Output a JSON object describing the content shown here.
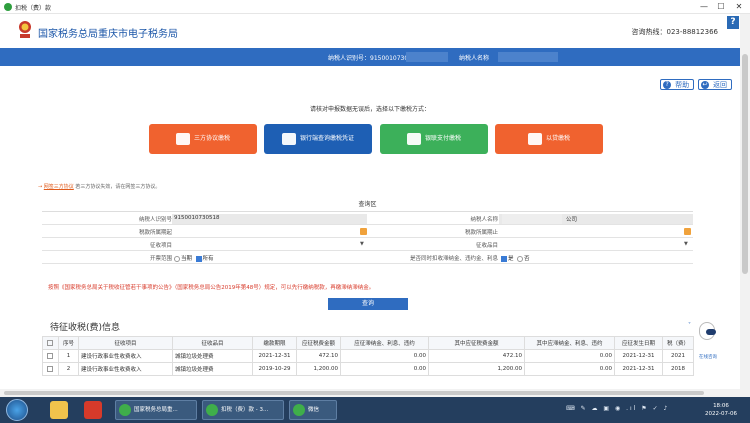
{
  "window": {
    "title": "扣税（费）款",
    "controls": {
      "minimize": "—",
      "maximize": "☐",
      "close": "✕"
    }
  },
  "header": {
    "site_title": "国家税务总局重庆市电子税务局",
    "hotline": "咨询热线：023-88812366",
    "help_tab": "?"
  },
  "taxpayer_bar": {
    "id_label": "纳税人识别号：91500107305",
    "name_label": "纳税人名称"
  },
  "top_links": {
    "help": "帮助",
    "back": "返回"
  },
  "prompt": "请核对申报数据无误后，选择以下缴税方式：",
  "pay_methods": [
    {
      "label": "三方协议缴税",
      "color": "#f0622f"
    },
    {
      "label": "银行端查询缴税凭证",
      "color": "#1e5fb4"
    },
    {
      "label": "银联支付缴税",
      "color": "#3cb05a"
    },
    {
      "label": "以贷缴税",
      "color": "#f0622f"
    }
  ],
  "agreement": {
    "link": "网签三方协议",
    "text": "若三方协议失效，请在网签三方协议。"
  },
  "query_area": {
    "title": "查询区",
    "fields": {
      "taxpayer_id_label": "纳税人识别号",
      "taxpayer_id_value": "9150010730518",
      "taxpayer_name_label": "纳税人名称",
      "taxpayer_name_suffix": "公司",
      "period_start_label": "税款所属期起",
      "period_end_label": "税款所属期止",
      "levy_item_label": "征收项目",
      "levy_sub_label": "征收品目",
      "scope_label": "开票范围",
      "scope_opt1": "当期",
      "scope_opt2": "所有",
      "late_fee_label": "是否同时扣收滞纳金、违约金、利息",
      "late_yes": "是",
      "late_no": "否"
    },
    "notice": "按照《国家税务总局关于税收征管若干事项的公告》（国家税务总局公告2019年第48号）规定，可以先行缴纳税款，再缴滞纳滞纳金。",
    "query_button": "查询"
  },
  "pending": {
    "title": "待征收税(费)信息",
    "collapse": "˅",
    "columns": [
      "",
      "序号",
      "征收项目",
      "征收品目",
      "缴款期限",
      "应征税费金额",
      "应征滞纳金、利息、违约",
      "其中应征税费金额",
      "其中应滞纳金、利息、违约",
      "应征发生日期",
      "税（费）"
    ],
    "rows": [
      [
        "",
        "1",
        "建设行政事业性收费收入",
        "城镇垃圾处理费",
        "2021-12-31",
        "472.10",
        "0.00",
        "472.10",
        "0.00",
        "2021-12-31",
        "2021"
      ],
      [
        "",
        "2",
        "建设行政事业性收费收入",
        "城镇垃圾处理费",
        "2019-10-29",
        "1,200.00",
        "0.00",
        "1,200.00",
        "0.00",
        "2021-12-31",
        "2018"
      ]
    ]
  },
  "robot": {
    "label": "在线咨询"
  },
  "taskbar": {
    "tasks": [
      {
        "label": "国家税务总局重..."
      },
      {
        "label": "扣税（费）款 - 3..."
      },
      {
        "label": "微信"
      }
    ],
    "tray": "⌨ ✎ ☁ ▣ ◉ .ıl ⚑ ✓ ♪",
    "time": "18:06",
    "date": "2022-07-06"
  }
}
